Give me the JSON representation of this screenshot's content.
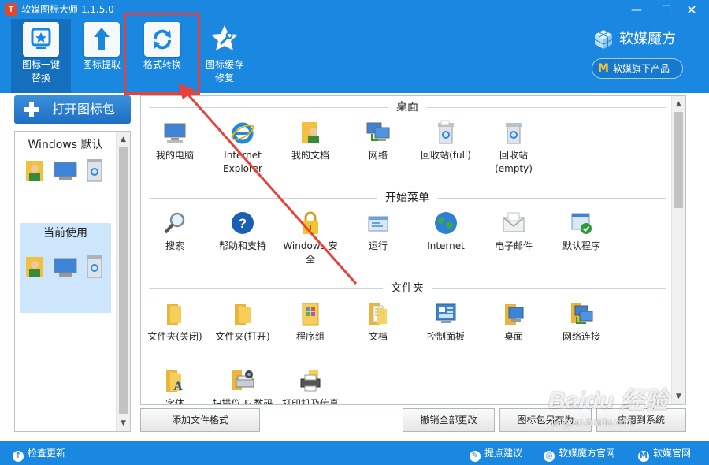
{
  "app": {
    "title": "软媒图标大师 1.1.5.0",
    "logo_letter": "T"
  },
  "window_controls": {
    "minimize": "—",
    "maximize": "☐",
    "close": "✕"
  },
  "toolbar": [
    {
      "label": "图标一键\n替换",
      "icon": "star-frame-icon",
      "active": true
    },
    {
      "label": "图标提取",
      "icon": "up-arrow-icon",
      "active": false
    },
    {
      "label": "格式转换",
      "icon": "refresh-arrows-icon",
      "active": false
    },
    {
      "label": "图标缓存\n修复",
      "icon": "wrench-star-icon",
      "active": false
    }
  ],
  "brand": {
    "name": "软媒魔方",
    "products_label": "软媒旗下产品",
    "products_icon_letter": "M"
  },
  "left_panel": {
    "open_pack_label": "打开图标包",
    "packs": [
      {
        "name": "Windows 默认",
        "selected": false
      },
      {
        "name": "当前使用",
        "selected": true
      }
    ]
  },
  "sections": [
    {
      "title": "桌面",
      "items": [
        {
          "name": "我的电脑",
          "icon": "computer-icon"
        },
        {
          "name": "Internet\nExplorer",
          "icon": "ie-icon"
        },
        {
          "name": "我的文档",
          "icon": "user-documents-icon"
        },
        {
          "name": "网络",
          "icon": "network-icon"
        },
        {
          "name": "回收站(full)",
          "icon": "recycle-bin-full-icon"
        },
        {
          "name": "回收站(empty)",
          "icon": "recycle-bin-empty-icon"
        }
      ]
    },
    {
      "title": "开始菜单",
      "items": [
        {
          "name": "搜索",
          "icon": "magnifier-icon"
        },
        {
          "name": "帮助和支持",
          "icon": "help-icon"
        },
        {
          "name": "Windows 安全",
          "icon": "lock-icon"
        },
        {
          "name": "运行",
          "icon": "run-icon"
        },
        {
          "name": "Internet",
          "icon": "globe-icon"
        },
        {
          "name": "电子邮件",
          "icon": "email-icon"
        },
        {
          "name": "默认程序",
          "icon": "default-programs-icon"
        }
      ]
    },
    {
      "title": "文件夹",
      "items": [
        {
          "name": "文件夹(关闭)",
          "icon": "folder-closed-icon"
        },
        {
          "name": "文件夹(打开)",
          "icon": "folder-open-icon"
        },
        {
          "name": "程序组",
          "icon": "program-group-icon"
        },
        {
          "name": "文档",
          "icon": "documents-folder-icon"
        },
        {
          "name": "控制面板",
          "icon": "control-panel-icon"
        },
        {
          "name": "桌面",
          "icon": "desktop-folder-icon"
        },
        {
          "name": "网络连接",
          "icon": "network-connections-icon"
        },
        {
          "name": "字体",
          "icon": "fonts-folder-icon"
        },
        {
          "name": "扫描仪 & 数码",
          "icon": "scanner-icon"
        },
        {
          "name": "打印机及传真",
          "icon": "printer-icon"
        }
      ]
    }
  ],
  "buttons": {
    "add_format": "添加文件格式",
    "undo_all": "撤销全部更改",
    "pack": "图标包另存为",
    "apply": "应用到系统"
  },
  "statusbar": {
    "check_update": "检查更新",
    "suggestion": "提点建议",
    "mofang_site": "软媒魔方官网",
    "ruanmei_site": "软媒官网"
  },
  "watermark": {
    "logo": "Baidu 经验",
    "url": "jingyan.baidu.com"
  },
  "colors": {
    "header_blue": "#1a87e0",
    "active_tool": "#1470bf",
    "highlight_red": "#e8413a",
    "selected_pack": "#cde6fb"
  }
}
